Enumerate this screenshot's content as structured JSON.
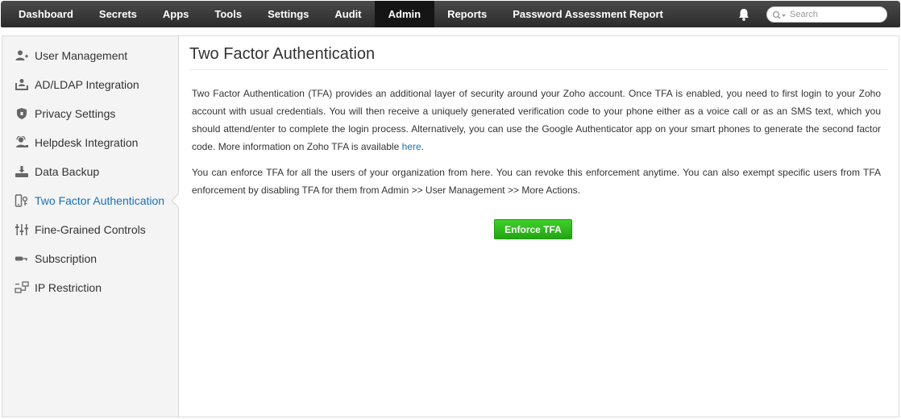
{
  "nav": {
    "items": [
      {
        "label": "Dashboard"
      },
      {
        "label": "Secrets"
      },
      {
        "label": "Apps"
      },
      {
        "label": "Tools"
      },
      {
        "label": "Settings"
      },
      {
        "label": "Audit"
      },
      {
        "label": "Admin"
      },
      {
        "label": "Reports"
      },
      {
        "label": "Password Assessment Report"
      }
    ],
    "active": "Admin",
    "bell_icon": "bell-icon",
    "search": {
      "placeholder": "Search",
      "icon": "search-icon"
    }
  },
  "sidebar": {
    "items": [
      {
        "label": "User Management",
        "icon": "user-add-icon"
      },
      {
        "label": "AD/LDAP Integration",
        "icon": "directory-icon"
      },
      {
        "label": "Privacy Settings",
        "icon": "shield-icon"
      },
      {
        "label": "Helpdesk Integration",
        "icon": "helpdesk-icon"
      },
      {
        "label": "Data Backup",
        "icon": "backup-icon"
      },
      {
        "label": "Two Factor Authentication",
        "icon": "tfa-icon"
      },
      {
        "label": "Fine-Grained Controls",
        "icon": "sliders-icon"
      },
      {
        "label": "Subscription",
        "icon": "key-icon"
      },
      {
        "label": "IP Restriction",
        "icon": "network-icon"
      }
    ],
    "active": "Two Factor Authentication"
  },
  "main": {
    "title": "Two Factor Authentication",
    "para1_text": "Two Factor Authentication (TFA) provides an additional layer of security around your Zoho account. Once TFA is enabled, you need to first login to your Zoho account with usual credentials. You will then receive a uniquely generated verification code to your phone either as a voice call or as an SMS text, which you should attend/enter to complete the login process. Alternatively, you can use the Google Authenticator app on your smart phones to generate the second factor code. More information on Zoho TFA is available ",
    "para1_link": "here",
    "para1_end": ".",
    "para2": "You can enforce TFA for all the users of your organization from here. You can revoke this enforcement anytime. You can also exempt specific users from TFA enforcement by disabling TFA for them from Admin >> User Management >> More Actions.",
    "button_label": "Enforce TFA"
  },
  "colors": {
    "topbar": "#333333",
    "active_link": "#1a72b5",
    "button_green": "#2db91c"
  }
}
